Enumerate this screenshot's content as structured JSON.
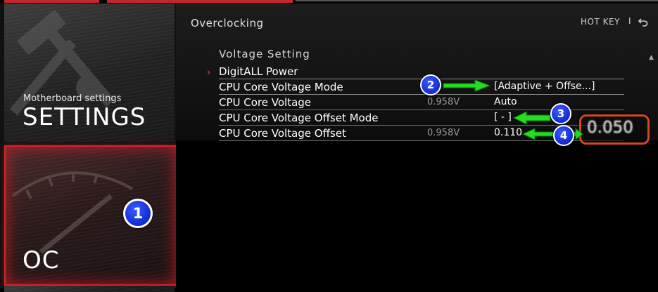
{
  "sidebar": {
    "settings": {
      "subtitle": "Motherboard settings",
      "title": "SETTINGS",
      "icon": "wrench-hammer-icon"
    },
    "oc": {
      "title": "OC",
      "icon": "gauge-icon"
    }
  },
  "header": {
    "breadcrumb": "Overclocking",
    "hotkey_label": "HOT KEY",
    "separator": "I",
    "back_icon": "back-arrow-icon"
  },
  "section": {
    "title": "Voltage Setting",
    "rows": [
      {
        "name": "DigitALL Power",
        "current": "",
        "value": ""
      },
      {
        "name": "CPU Core Voltage Mode",
        "current": "",
        "value": "[Adaptive + Offse...]"
      },
      {
        "name": "CPU Core Voltage",
        "current": "0.958V",
        "value": "Auto"
      },
      {
        "name": "CPU Core Voltage Offset Mode",
        "current": "",
        "value": "[ - ]"
      },
      {
        "name": "CPU Core Voltage Offset",
        "current": "0.958V",
        "value": "0.110"
      }
    ]
  },
  "annotations": {
    "badges": [
      "1",
      "2",
      "3",
      "4"
    ],
    "highlight_value": "0.050",
    "arrow_color": "#22dd22",
    "badge_color": "#1532d8",
    "highlight_border": "#d04a1a"
  },
  "colors": {
    "accent": "#d4232b"
  }
}
